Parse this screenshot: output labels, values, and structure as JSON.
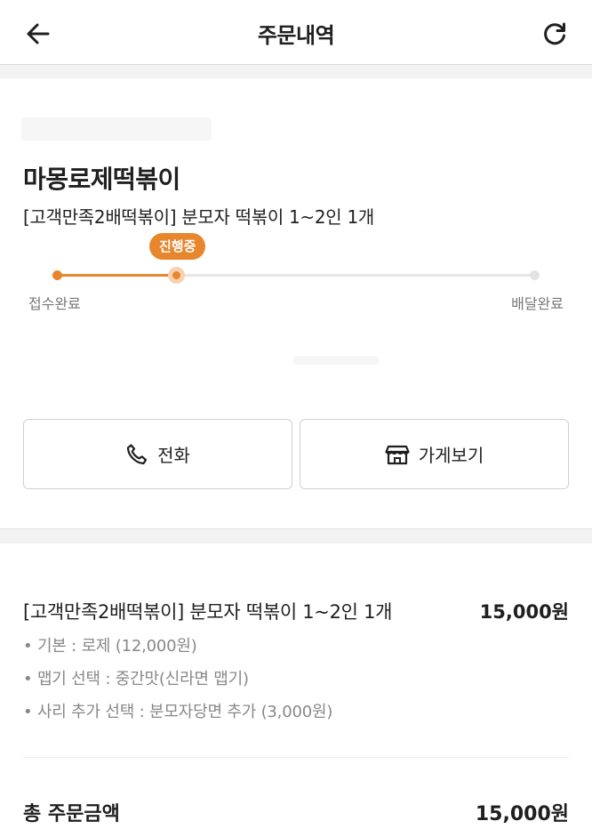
{
  "header": {
    "title": "주문내역",
    "back_icon": "arrow-left-icon",
    "refresh_icon": "refresh-icon"
  },
  "order": {
    "store_name": "마몽로제떡볶이",
    "menu_summary": "[고객만족2배떡볶이] 분모자 떡볶이 1~2인 1개",
    "status_badge": "진행중",
    "progress_fraction": 0.25,
    "step_start": "접수완료",
    "step_end": "배달완료",
    "accent_color": "#e8862e"
  },
  "actions": {
    "call_label": "전화",
    "call_icon": "phone-icon",
    "store_label": "가게보기",
    "store_icon": "store-icon"
  },
  "details": {
    "item_name": "[고객만족2배떡볶이] 분모자 떡볶이 1~2인 1개",
    "item_price": "15,000원",
    "options": [
      "• 기본 : 로제 (12,000원)",
      "• 맵기 선택 : 중간맛(신라면 맵기)",
      "• 사리 추가 선택 : 분모자당면 추가 (3,000원)"
    ],
    "total_label": "총 주문금액",
    "total_value": "15,000원"
  }
}
